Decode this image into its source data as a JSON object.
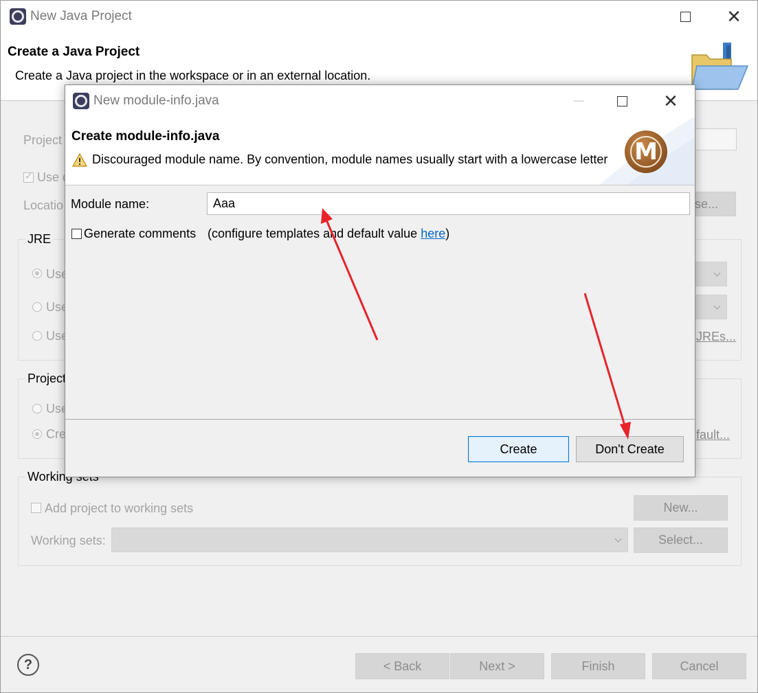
{
  "outer": {
    "title": "New Java Project",
    "banner_title": "Create a Java Project",
    "banner_desc": "Create a Java project in the workspace or in an external location.",
    "project_label": "Project",
    "use_default_label": "Use d",
    "location_label": "Locatio",
    "browse_label": "se...",
    "jre_group": "JRE",
    "jre_opt1": "Use",
    "jre_opt2": "Use",
    "jre_opt3": "Use",
    "configure_jres": "JREs...",
    "layout_group": "Project",
    "layout_opt1": "Use",
    "layout_opt2": "Cre",
    "configure_default": "fault...",
    "working_sets_group": "Working sets",
    "add_to_ws": "Add project to working sets",
    "ws_new": "New...",
    "ws_label": "Working sets:",
    "ws_select": "Select...",
    "back": "< Back",
    "next": "Next >",
    "finish": "Finish",
    "cancel": "Cancel",
    "help": "?"
  },
  "modal": {
    "title": "New module-info.java",
    "banner_title": "Create module-info.java",
    "warning": "Discouraged module name. By convention, module names usually start with a lowercase letter",
    "module_label": "Module name:",
    "module_value": "Aaa",
    "gen_comments": "Generate comments",
    "configure_prefix": "(configure templates and default value ",
    "here": "here",
    "configure_suffix": ")",
    "create": "Create",
    "dont_create": "Don't Create",
    "icon_letter": "M"
  },
  "annotation": {
    "arrow_color": "#e8232a"
  }
}
